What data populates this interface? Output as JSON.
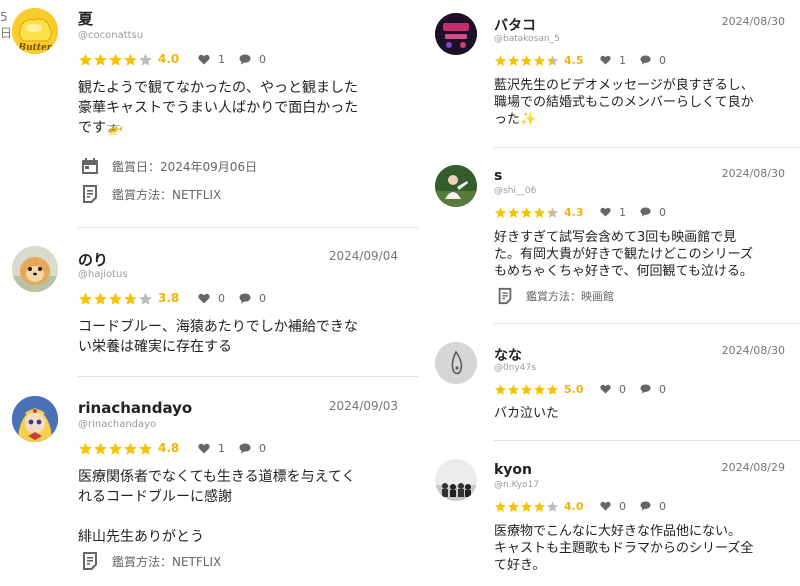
{
  "reviews_left": [
    {
      "username": "夏",
      "handle": "@coconattsu",
      "date": "5日",
      "score": "4.0",
      "rating": 4.0,
      "likes": "1",
      "comments": "0",
      "text": "観たようで観てなかったの、やっと観ました\n豪華キャストでうまい人ばかりで面白かった\nです🚁",
      "watch_date": "鑑賞日：2024年09月06日",
      "watch_method": "鑑賞方法：NETFLIX"
    },
    {
      "username": "のり",
      "handle": "@hajiotus",
      "date": "2024/09/04",
      "score": "3.8",
      "rating": 3.8,
      "likes": "0",
      "comments": "0",
      "text": "コードブルー、海猿あたりでしか補給できな\nい栄養は確実に存在する"
    },
    {
      "username": "rinachandayo",
      "handle": "@rinachandayo",
      "date": "2024/09/03",
      "score": "4.8",
      "rating": 4.8,
      "likes": "1",
      "comments": "0",
      "text": "医療関係者でなくても生きる道標を与えてく\nれるコードブルーに感謝\n\n緋山先生ありがとう",
      "watch_method": "鑑賞方法：NETFLIX"
    }
  ],
  "reviews_right": [
    {
      "username": "バタコ",
      "handle": "@batakosan_5",
      "date": "2024/08/30",
      "score": "4.5",
      "rating": 4.5,
      "likes": "1",
      "comments": "0",
      "text": "藍沢先生のビデオメッセージが良すぎるし、\n職場での結婚式もこのメンバーらしくて良か\nった✨"
    },
    {
      "username": "s",
      "handle": "@shi__06",
      "date": "2024/08/30",
      "score": "4.3",
      "rating": 4.3,
      "likes": "1",
      "comments": "0",
      "text": "好きすぎて試写会含めて3回も映画館で見\nた。有岡大貴が好きで観たけどこのシリーズ\nもめちゃくちゃ好きで、何回観ても泣ける。",
      "watch_method": "鑑賞方法：映画館"
    },
    {
      "username": "なな",
      "handle": "@0ny47s",
      "date": "2024/08/30",
      "score": "5.0",
      "rating": 5.0,
      "likes": "0",
      "comments": "0",
      "text": "バカ泣いた"
    },
    {
      "username": "kyon",
      "handle": "@n.Kyo17",
      "date": "2024/08/29",
      "score": "4.0",
      "rating": 4.0,
      "likes": "0",
      "comments": "0",
      "text": "医療物でこんなに大好きな作品他にない。\nキャストも主題歌もドラマからのシリーズ全\nて好き。"
    }
  ],
  "colors": {
    "star_filled": "#f5c400",
    "star_empty": "#bdbdbd",
    "score_text": "#f2b600",
    "divider": "#e2e2e2"
  },
  "icons": {
    "star": "star-icon",
    "like": "heart-icon",
    "comment": "comment-bubble-icon",
    "calendar": "calendar-icon",
    "method": "document-icon"
  }
}
